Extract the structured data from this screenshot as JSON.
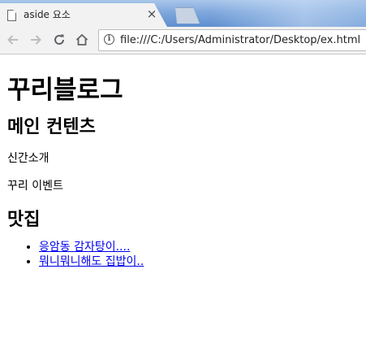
{
  "browser": {
    "tab_title": "aside 요소",
    "tab_close": "×",
    "url": "file:///C:/Users/Administrator/Desktop/ex.html",
    "info_glyph": "i"
  },
  "page": {
    "heading": "꾸리블로그",
    "main_section_heading": "메인 컨텐츠",
    "paragraphs": [
      "신간소개",
      "꾸리 이벤트"
    ],
    "restaurant_heading": "맛집",
    "restaurant_links": [
      "응암동 감자탕이....",
      "뭐니뭐니해도 집밥이.."
    ]
  }
}
